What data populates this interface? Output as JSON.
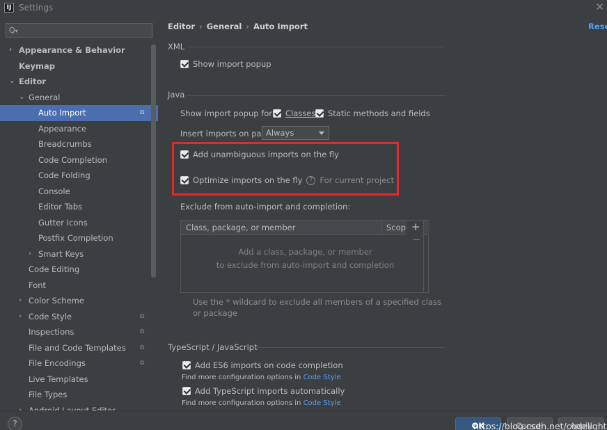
{
  "window": {
    "title": "Settings",
    "app_icon_letter": "IJ"
  },
  "search": {
    "placeholder": ""
  },
  "sidebar": {
    "items": [
      {
        "label": "Appearance & Behavior",
        "level": 0,
        "bold": true,
        "arrow": "›"
      },
      {
        "label": "Keymap",
        "level": 0,
        "bold": true,
        "arrow": ""
      },
      {
        "label": "Editor",
        "level": 0,
        "bold": true,
        "arrow": "⌄"
      },
      {
        "label": "General",
        "level": 1,
        "bold": false,
        "arrow": "⌄"
      },
      {
        "label": "Auto Import",
        "level": 2,
        "selected": true,
        "cfg": true
      },
      {
        "label": "Appearance",
        "level": 2
      },
      {
        "label": "Breadcrumbs",
        "level": 2
      },
      {
        "label": "Code Completion",
        "level": 2
      },
      {
        "label": "Code Folding",
        "level": 2
      },
      {
        "label": "Console",
        "level": 2
      },
      {
        "label": "Editor Tabs",
        "level": 2
      },
      {
        "label": "Gutter Icons",
        "level": 2
      },
      {
        "label": "Postfix Completion",
        "level": 2
      },
      {
        "label": "Smart Keys",
        "level": 2,
        "arrow": "›"
      },
      {
        "label": "Code Editing",
        "level": 1
      },
      {
        "label": "Font",
        "level": 1
      },
      {
        "label": "Color Scheme",
        "level": 1,
        "arrow": "›"
      },
      {
        "label": "Code Style",
        "level": 1,
        "arrow": "›",
        "cfg": true
      },
      {
        "label": "Inspections",
        "level": 1,
        "cfg": true
      },
      {
        "label": "File and Code Templates",
        "level": 1,
        "cfg": true
      },
      {
        "label": "File Encodings",
        "level": 1,
        "cfg": true
      },
      {
        "label": "Live Templates",
        "level": 1
      },
      {
        "label": "File Types",
        "level": 1
      },
      {
        "label": "Android Layout Editor",
        "level": 1,
        "arrow": "›"
      }
    ]
  },
  "breadcrumb": {
    "part1": "Editor",
    "part2": "General",
    "part3": "Auto Import",
    "reset": "Reset"
  },
  "xml": {
    "section": "XML",
    "show_import_popup": "Show import popup"
  },
  "java": {
    "section": "Java",
    "popup_for_label": "Show import popup for:",
    "classes": "Classes",
    "static_methods": "Static methods and fields",
    "insert_label": "Insert imports on paste:",
    "insert_value": "Always",
    "add_unambiguous": "Add unambiguous imports on the fly",
    "optimize": "Optimize imports on the fly",
    "optimize_hint": "For current project",
    "exclude_label": "Exclude from auto-import and completion:",
    "table": {
      "col1": "Class, package, or member",
      "col2": "Scope",
      "empty_line1": "Add a class, package, or member",
      "empty_line2": "to exclude from auto-import and completion"
    },
    "wildcard_note": "Use the * wildcard to exclude all members of a specified class or package"
  },
  "ts": {
    "section": "TypeScript / JavaScript",
    "es6": "Add ES6 imports on code completion",
    "find_more": "Find more configuration options in",
    "code_style": "Code Style",
    "ts_auto": "Add TypeScript imports automatically",
    "find_more2": "Find more configuration options in",
    "code_style2": "Code Style"
  },
  "footer": {
    "help": "?",
    "ok": "OK",
    "cancel": "Cancel",
    "apply": "Apply"
  },
  "watermark": "https://blog.csdn.net/codelight",
  "colors": {
    "accent": "#4b6eaf",
    "link": "#589df6",
    "highlight": "#e8262c"
  }
}
